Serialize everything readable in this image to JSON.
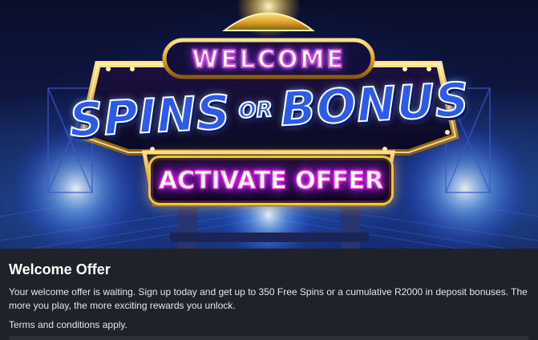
{
  "banner": {
    "sign_top": "WELCOME",
    "headline_part1": "SPINS",
    "headline_or": "OR",
    "headline_part2": "BONUS",
    "cta_label": "ACTIVATE OFFER"
  },
  "offer": {
    "title": "Welcome Offer",
    "description": "Your welcome offer is waiting. Sign up today and get up to 350 Free Spins or a cumulative R2000 in deposit bonuses. The more you play, the more exciting rewards you unlock.",
    "terms": "Terms and conditions apply."
  },
  "colors": {
    "page_background": "#1b1e24",
    "card_background": "#1f2229",
    "title_text": "#ffffff",
    "body_text": "#e4e6ea",
    "sign_gold": "#f2c64a",
    "neon_pink": "#ff3df0",
    "headline_blue": "#2b5be8"
  }
}
